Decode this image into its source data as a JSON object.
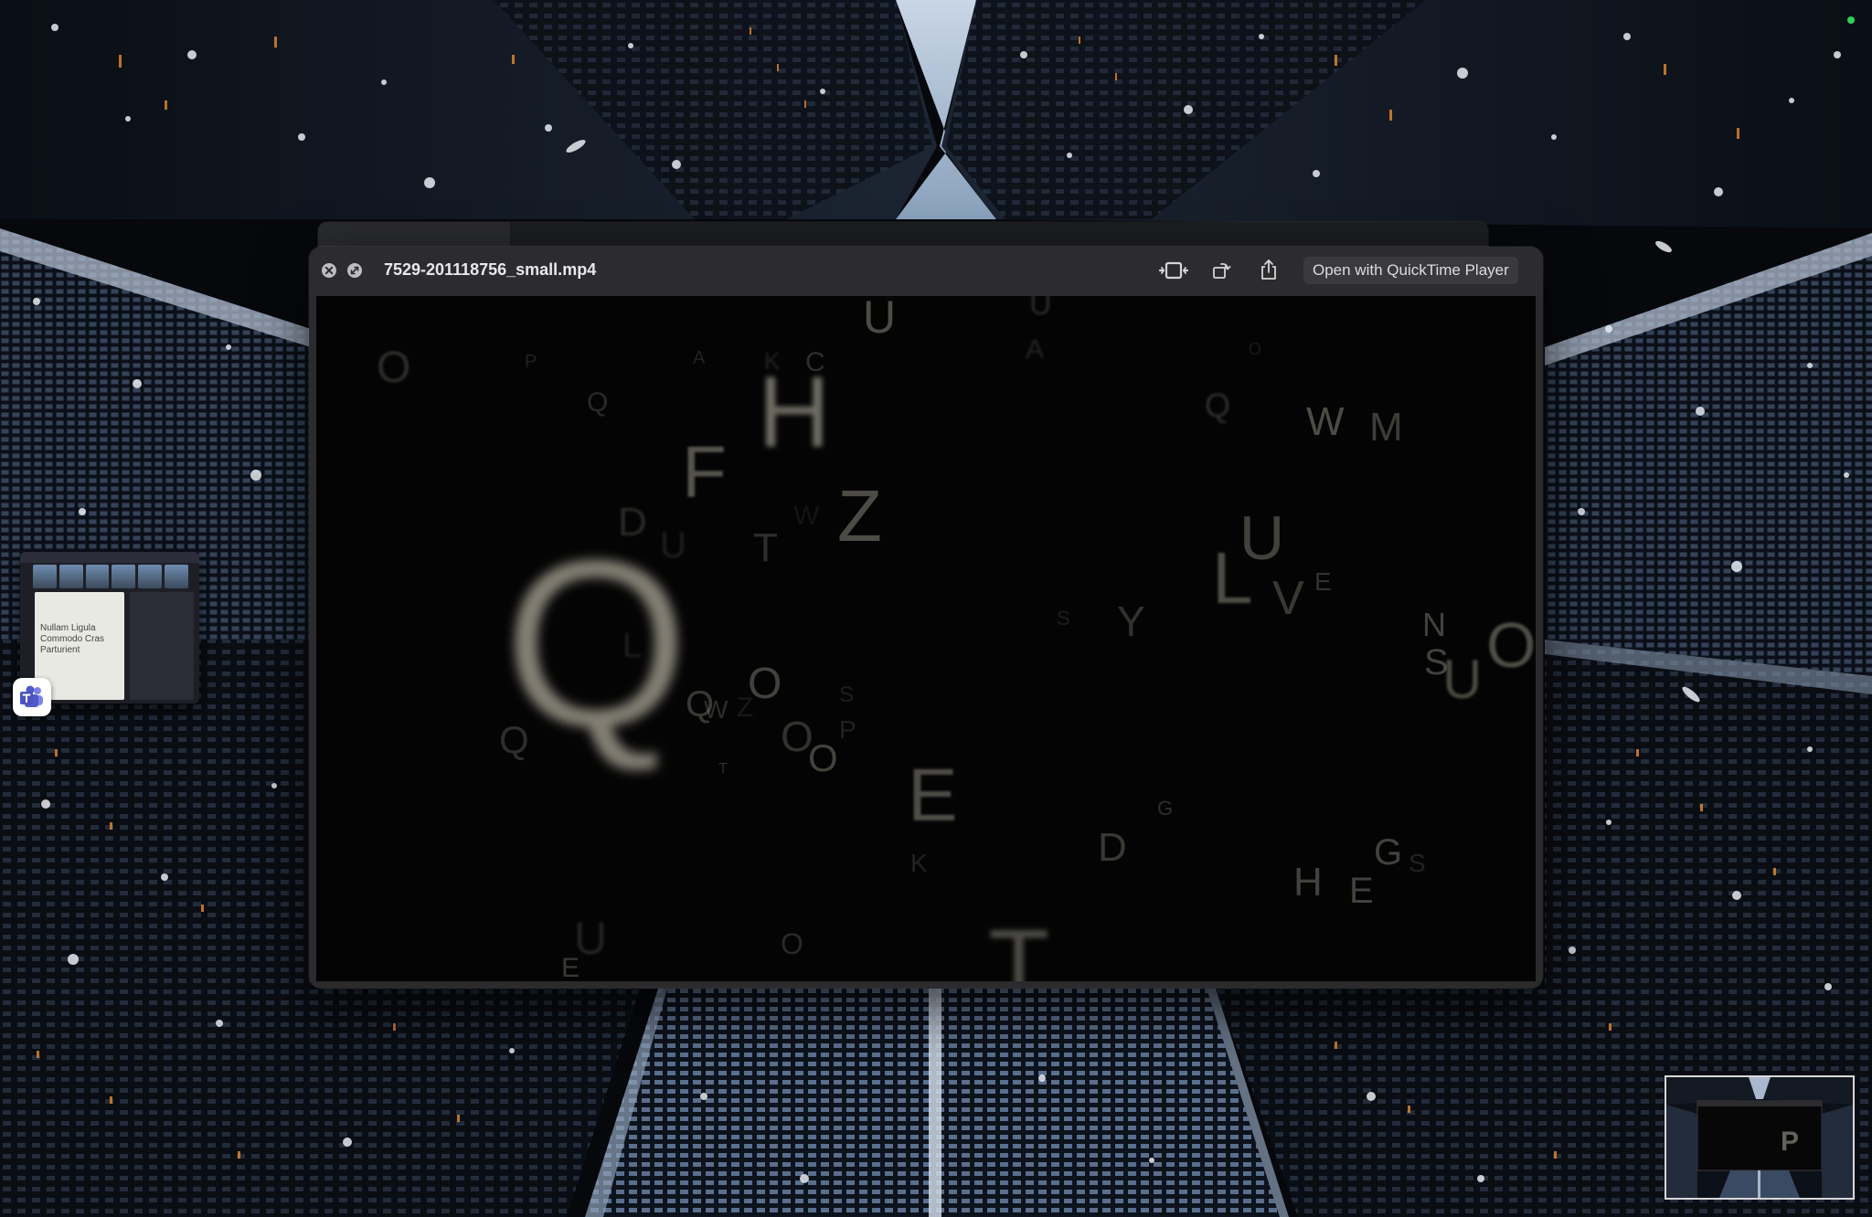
{
  "quicklook": {
    "filename": "7529-201118756_small.mp4",
    "open_with_label": "Open with QuickTime Player",
    "icons": {
      "close": "close-icon",
      "fullscreen": "fullscreen-icon",
      "trim": "trim-icon",
      "rotate": "rotate-icon",
      "share": "share-icon"
    }
  },
  "teams_thumbnail": {
    "doc_title": "Nullam Ligula Commodo Cras Parturient",
    "app_icon": "microsoft-teams-icon"
  },
  "status": {
    "indicator_color": "#2fd158"
  },
  "video": {
    "visible_letters": [
      "U",
      "U",
      "L",
      "O",
      "P",
      "A",
      "K",
      "C",
      "A",
      "O",
      "H",
      "Q",
      "Q",
      "W",
      "M",
      "F",
      "D",
      "U",
      "T",
      "Z",
      "W",
      "U",
      "L",
      "V",
      "E",
      "Q",
      "Y",
      "S",
      "N",
      "U",
      "S",
      "O",
      "Q",
      "W",
      "Z",
      "O",
      "P",
      "Q",
      "T",
      "O",
      "E",
      "D",
      "K",
      "G",
      "G",
      "S",
      "H",
      "E",
      "T",
      "U",
      "O",
      "E",
      "S",
      "O"
    ]
  }
}
